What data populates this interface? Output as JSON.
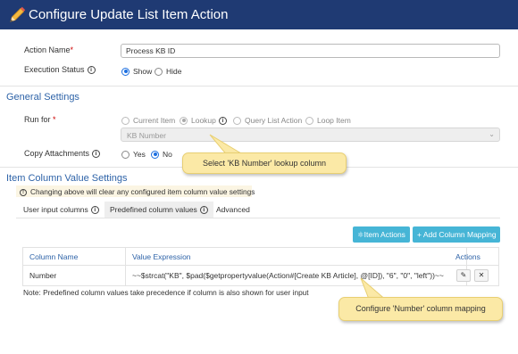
{
  "window": {
    "title": "Configure Update List Item Action"
  },
  "fields": {
    "action_name_label": "Action Name",
    "required_mark": "*",
    "action_name_value": "Process KB ID",
    "exec_status_label": "Execution Status",
    "exec_show": "Show",
    "exec_hide": "Hide"
  },
  "general": {
    "heading": "General Settings",
    "run_for_label": "Run for",
    "run_options": [
      "Current Item",
      "Lookup",
      "Query List Action",
      "Loop Item"
    ],
    "lookup_value": "KB Number",
    "copy_label": "Copy Attachments",
    "copy_yes": "Yes",
    "copy_no": "No"
  },
  "column_settings": {
    "heading": "Item Column Value Settings",
    "notice": "Changing above will clear any configured item column value settings",
    "tabs": [
      "User input columns",
      "Predefined column values",
      "Advanced"
    ],
    "item_actions_label": "Item Actions",
    "add_mapping_label": "+ Add Column Mapping",
    "headers": {
      "column_name": "Column Name",
      "value_expression": "Value Expression",
      "actions": "Actions"
    },
    "rows": [
      {
        "column_name": "Number",
        "value_expression": "~~$strcat(\"KB\", $pad($getpropertyvalue(Action#[Create KB Article], @[ID]), \"6\", \"0\", \"left\"))~~"
      }
    ],
    "note": "Note: Predefined column values take precedence if column is also shown for user input"
  },
  "callouts": {
    "lookup": "Select 'KB Number' lookup column",
    "mapping": "Configure 'Number' column mapping"
  },
  "icons": {
    "title": "pencil-icon",
    "info": "info-circle-icon",
    "item_actions": "sitemap-icon",
    "edit": "pencil-icon",
    "delete": "close-icon",
    "dropdown": "chevron-down-icon"
  },
  "colors": {
    "titlebar": "#1f3a73",
    "section_heading": "#2e63a8",
    "button": "#46b5d6",
    "callout": "#fbe9a6",
    "radio_selected": "#1d6fe0"
  }
}
